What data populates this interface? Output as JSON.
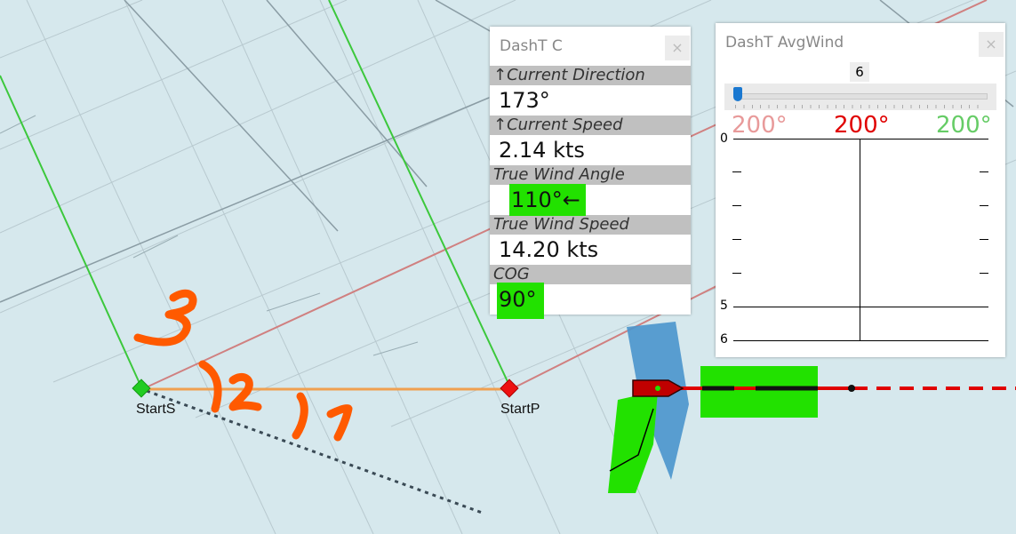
{
  "map": {
    "mark_starboard": "StartS",
    "mark_port": "StartP",
    "annotations": [
      "3",
      "2",
      "1"
    ]
  },
  "current_panel": {
    "title": "DashT C",
    "close": "×",
    "rows": [
      {
        "label": "↑Current Direction",
        "value": "173°"
      },
      {
        "label": "↑Current Speed",
        "value": "2.14 kts"
      },
      {
        "label": "True Wind Angle",
        "value": "110°←"
      },
      {
        "label": "True Wind Speed",
        "value": "14.20 kts"
      },
      {
        "label": "COG",
        "value": "90°"
      }
    ]
  },
  "wind_panel": {
    "title": "DashT AvgWind",
    "close": "×",
    "slider_value": "6",
    "slider_fraction": 0.0,
    "dir_left": "200°",
    "dir_center": "200°",
    "dir_right": "200°",
    "y_top": "0",
    "y_mid": "5",
    "y_bottom": "6"
  },
  "colors": {
    "water": "#d6e8ed",
    "laylines": "#3cc83c",
    "start_line": "#f0a050",
    "highlight": "#22e100",
    "boat": "#c80000",
    "annotation": "#ff5a00",
    "dir_left": "#e89a9a",
    "dir_center": "#e00000",
    "dir_right": "#66cc66"
  }
}
